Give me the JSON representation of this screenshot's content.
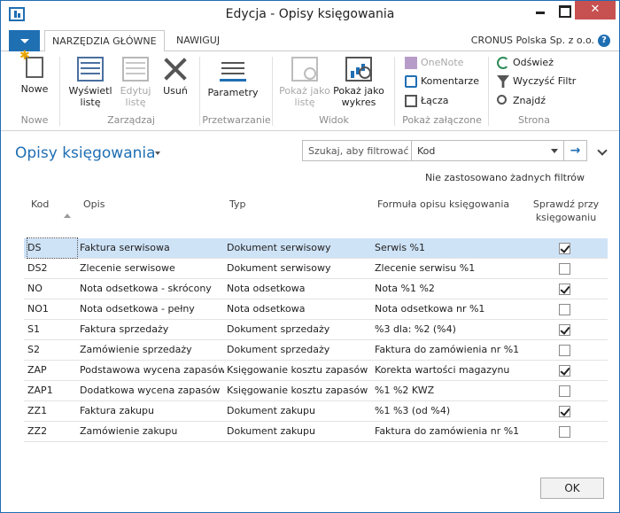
{
  "window": {
    "title": "Edycja - Opisy księgowania",
    "close_glyph": "✕"
  },
  "tabs": {
    "home": "NARZĘDZIA GŁÓWNE",
    "navigate": "NAWIGUJ"
  },
  "company": "CRONUS Polska Sp. z o.o.",
  "help_glyph": "?",
  "ribbon": {
    "new": {
      "label": "Nowe"
    },
    "show_list": {
      "label": "Wyświetl listę"
    },
    "edit_list": {
      "label": "Edytuj listę"
    },
    "delete": {
      "label": "Usuń"
    },
    "parameters": {
      "label": "Parametry"
    },
    "show_as_list": {
      "label": "Pokaż jako listę"
    },
    "show_as_chart": {
      "label": "Pokaż jako wykres"
    },
    "onenote": {
      "label": "OneNote"
    },
    "comments": {
      "label": "Komentarze"
    },
    "links": {
      "label": "Łącza"
    },
    "refresh": {
      "label": "Odśwież"
    },
    "clear_filter": {
      "label": "Wyczyść Filtr"
    },
    "find": {
      "label": "Znajdź"
    },
    "groups": {
      "new": "Nowe",
      "manage": "Zarządzaj",
      "process": "Przetwarzanie",
      "view": "Widok",
      "attachments": "Pokaż załączone",
      "page": "Strona"
    }
  },
  "page": {
    "title": "Opisy księgowania",
    "search_placeholder": "Szukaj, aby filtrować (...",
    "filter_field": "Kod",
    "go_glyph": "→",
    "filter_note": "Nie zastosowano żadnych filtrów"
  },
  "columns": {
    "kod": "Kod",
    "opis": "Opis",
    "typ": "Typ",
    "formula": "Formuła opisu księgowania",
    "check": "Sprawdź przy księgowaniu"
  },
  "rows": [
    {
      "kod": "DS",
      "opis": "Faktura serwisowa",
      "typ": "Dokument serwisowy",
      "formula": "Serwis %1",
      "check": true
    },
    {
      "kod": "DS2",
      "opis": "Zlecenie serwisowe",
      "typ": "Dokument serwisowy",
      "formula": "Zlecenie serwisu %1",
      "check": false
    },
    {
      "kod": "NO",
      "opis": "Nota odsetkowa - skrócony",
      "typ": "Nota odsetkowa",
      "formula": "Nota %1 %2",
      "check": true
    },
    {
      "kod": "NO1",
      "opis": "Nota odsetkowa - pełny",
      "typ": "Nota odsetkowa",
      "formula": "Nota odsetkowa nr %1",
      "check": false
    },
    {
      "kod": "S1",
      "opis": "Faktura sprzedaży",
      "typ": "Dokument sprzedaży",
      "formula": "%3 dla: %2 (%4)",
      "check": true
    },
    {
      "kod": "S2",
      "opis": "Zamówienie sprzedaży",
      "typ": "Dokument sprzedaży",
      "formula": "Faktura do zamówienia nr %1",
      "check": false
    },
    {
      "kod": "ZAP",
      "opis": "Podstawowa wycena zapasów",
      "typ": "Księgowanie kosztu zapasów",
      "formula": "Korekta wartości magazynu",
      "check": true
    },
    {
      "kod": "ZAP1",
      "opis": "Dodatkowa wycena zapasów",
      "typ": "Księgowanie kosztu zapasów",
      "formula": "%1 %2 KWZ",
      "check": false
    },
    {
      "kod": "ZZ1",
      "opis": "Faktura zakupu",
      "typ": "Dokument zakupu",
      "formula": "%1 %3 (od %4)",
      "check": true
    },
    {
      "kod": "ZZ2",
      "opis": "Zamówienie zakupu",
      "typ": "Dokument zakupu",
      "formula": "Faktura do zamówienia nr %1",
      "check": false
    }
  ],
  "ok_button": "OK"
}
